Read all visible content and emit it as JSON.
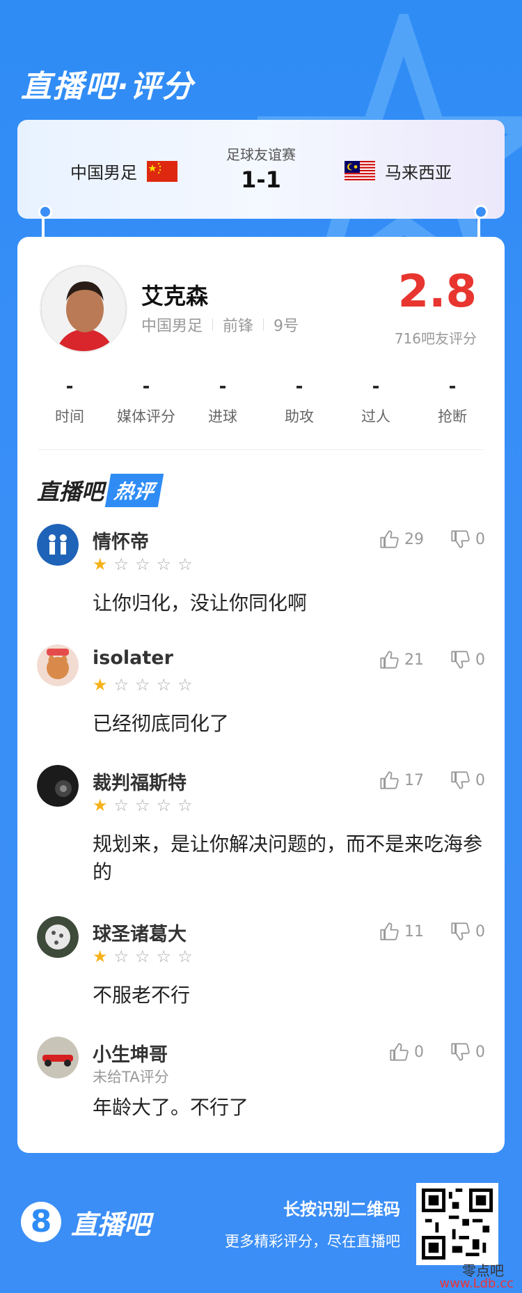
{
  "header": {
    "title": "直播吧·评分"
  },
  "match": {
    "home_team": "中国男足",
    "away_team": "马来西亚",
    "type": "足球友谊赛",
    "score": "1-1"
  },
  "player": {
    "name": "艾克森",
    "team": "中国男足",
    "position": "前锋",
    "number": "9号",
    "rating": "2.8",
    "rating_count": "716吧友评分"
  },
  "stats": [
    {
      "label": "时间",
      "value": "-"
    },
    {
      "label": "媒体评分",
      "value": "-"
    },
    {
      "label": "进球",
      "value": "-"
    },
    {
      "label": "助攻",
      "value": "-"
    },
    {
      "label": "过人",
      "value": "-"
    },
    {
      "label": "抢断",
      "value": "-"
    }
  ],
  "hot_comments": {
    "title_a": "直播吧",
    "title_b": "热评",
    "items": [
      {
        "user": "情怀帝",
        "stars": 1,
        "likes": "29",
        "dislikes": "0",
        "text": "让你归化，没让你同化啊"
      },
      {
        "user": "isolater",
        "stars": 1,
        "likes": "21",
        "dislikes": "0",
        "text": "已经彻底同化了"
      },
      {
        "user": "裁判福斯特",
        "stars": 1,
        "likes": "17",
        "dislikes": "0",
        "text": "规划来，是让你解决问题的，而不是来吃海参的"
      },
      {
        "user": "球圣诸葛大",
        "stars": 1,
        "likes": "11",
        "dislikes": "0",
        "text": "不服老不行"
      },
      {
        "user": "小生坤哥",
        "unrated": "未给TA评分",
        "likes": "0",
        "dislikes": "0",
        "text": "年龄大了。不行了"
      }
    ]
  },
  "footer": {
    "logo_mark": "8",
    "logo_text": "直播吧",
    "line1": "长按识别二维码",
    "line2": "更多精彩评分，尽在直播吧"
  },
  "watermark": {
    "line1": "零点吧",
    "line2": "www.Ldb.cc"
  }
}
